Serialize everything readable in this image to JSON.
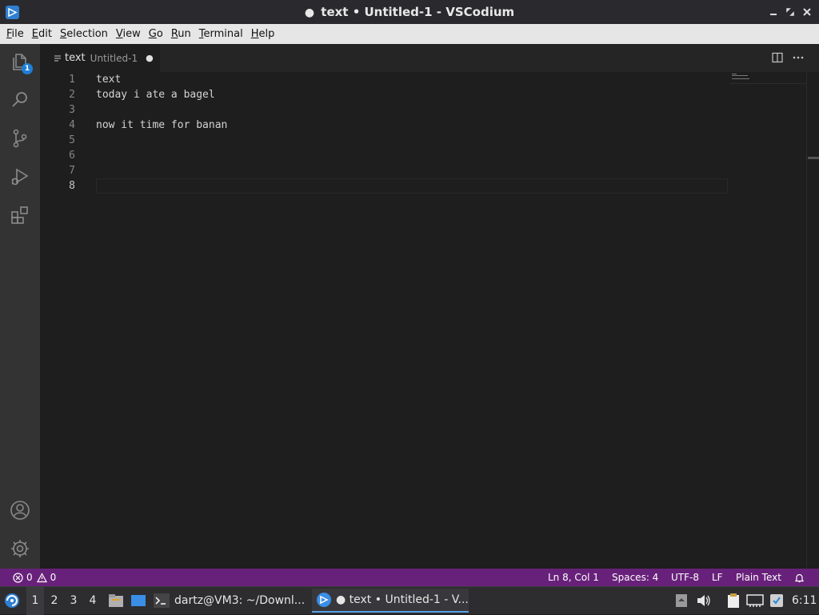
{
  "window": {
    "title_dot": "●",
    "title": "text • Untitled-1 - VSCodium"
  },
  "menu": [
    {
      "mnemonic": "F",
      "rest": "ile"
    },
    {
      "mnemonic": "E",
      "rest": "dit"
    },
    {
      "mnemonic": "S",
      "rest": "election"
    },
    {
      "mnemonic": "V",
      "rest": "iew"
    },
    {
      "mnemonic": "G",
      "rest": "o"
    },
    {
      "mnemonic": "R",
      "rest": "un"
    },
    {
      "mnemonic": "T",
      "rest": "erminal"
    },
    {
      "mnemonic": "H",
      "rest": "elp"
    }
  ],
  "activity": {
    "explorer_badge": "1",
    "items": [
      "files-icon",
      "search-icon",
      "source-control-icon",
      "run-debug-icon",
      "extensions-icon"
    ],
    "bottom": [
      "account-icon",
      "gear-icon"
    ]
  },
  "tab": {
    "name": "text",
    "description": "Untitled-1",
    "dirty": "●"
  },
  "editor": {
    "line_numbers": [
      "1",
      "2",
      "3",
      "4",
      "5",
      "6",
      "7",
      "8"
    ],
    "lines": [
      "text",
      "today i ate a bagel",
      "",
      "now it time for banan",
      "",
      "",
      "",
      ""
    ],
    "active_line": 8
  },
  "statusbar": {
    "errors": "0",
    "warnings": "0",
    "position": "Ln 8, Col 1",
    "spaces": "Spaces: 4",
    "encoding": "UTF-8",
    "eol": "LF",
    "language": "Plain Text"
  },
  "taskbar": {
    "workspaces": [
      "1",
      "2",
      "3",
      "4"
    ],
    "terminal_task": "dartz@VM3: ~/Downl...",
    "vscodium_task": "● text • Untitled-1 - V...",
    "clock": "6:11"
  },
  "colors": {
    "statusbar": "#68217a",
    "activitybar": "#333333",
    "editor_bg": "#1e1e1e",
    "badge": "#1f7fd6"
  }
}
